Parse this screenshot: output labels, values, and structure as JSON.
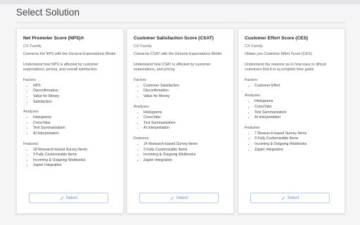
{
  "page": {
    "title": "Select Solution"
  },
  "cards": [
    {
      "title": "Net Promoter Score (NPS)®",
      "family": "CX Family",
      "desc1": "Connects the NPS with the General Expectations Model",
      "desc2": "Understand how NPS is affected by customer expectations, pricing, and overall satisfaction",
      "factors_label": "Factors",
      "factors": [
        "NPS",
        "Disconfirmation",
        "Value for Money",
        "Satisfaction"
      ],
      "analyses_label": "Analyses",
      "analyses": [
        "Histograms",
        "CrossTabs",
        "Text Summarization",
        "AI Interpretation"
      ],
      "features_label": "Features",
      "features": [
        "18 Research-based Survey Items",
        "3 Fully Customizable Items",
        "Incoming & Outgoing Webhooks",
        "Zapier Integration"
      ],
      "button": "Select"
    },
    {
      "title": "Customer Satisfaction Score (CSAT)",
      "family": "CX Family",
      "desc1": "Connects CSAT with the General Expectations Model",
      "desc2": "Understand how CSAT is affected by customer expectations, and pricing",
      "factors_label": "Factors",
      "factors": [
        "Customer Satisfaction",
        "Disconfirmation",
        "Value for Money"
      ],
      "analyses_label": "Analyses",
      "analyses": [
        "Histograms",
        "CrossTabs",
        "Text Summarization",
        "AI Interpretation"
      ],
      "features_label": "Features",
      "features": [
        "14 Research-based Survey Items",
        "3 Fully Customizable Items",
        "Incoming & Outgoing Webhooks",
        "Zapier Integration"
      ],
      "button": "Select"
    },
    {
      "title": "Customer Effort Score (CES)",
      "family": "CX Family",
      "desc1": "Obtain you Customer Effort Score (CES).",
      "desc2": "Understand the reasons as to how easy or dificult customers find it to accomplish their goals.",
      "factors_label": "Factors",
      "factors": [
        "Customer Effort"
      ],
      "analyses_label": "Analyses",
      "analyses": [
        "Histograms",
        "CrossTabs",
        "Text Summarization",
        "AI Interpretation"
      ],
      "features_label": "Features",
      "features": [
        "7 Research-based Survey Items",
        "3 Fully Customizable Items",
        "Incoming & Outgoing Webhooks",
        "Zapier Integration"
      ],
      "button": "Select"
    }
  ],
  "icons": {
    "select": "magic-wand-icon"
  },
  "colors": {
    "accent": "#6b8ccf",
    "button_border": "#b9c9e6"
  }
}
